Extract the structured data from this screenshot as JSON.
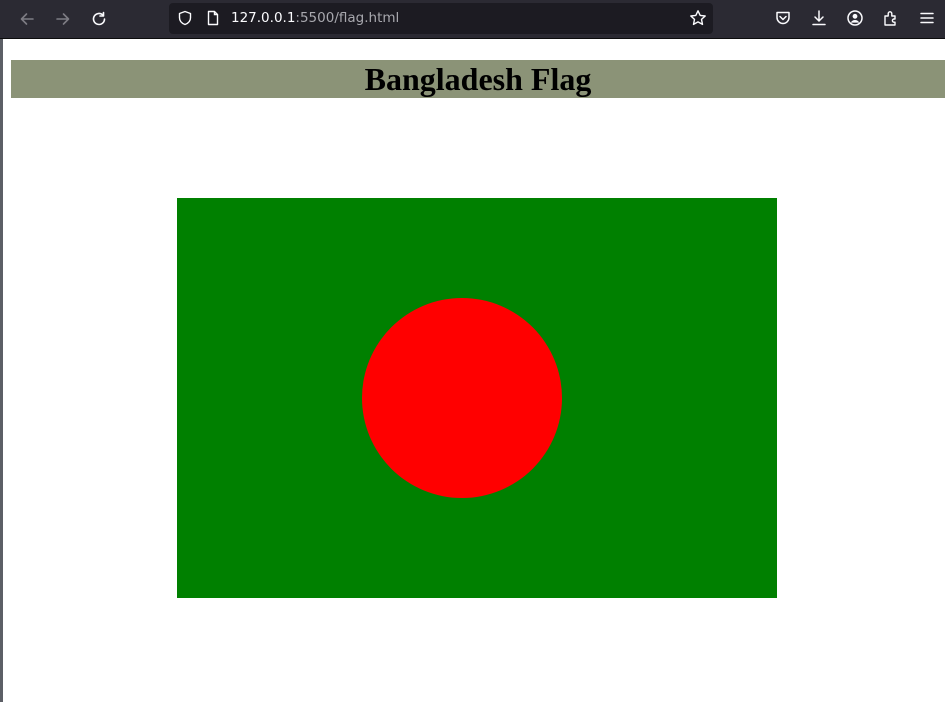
{
  "browser": {
    "url_host": "127.0.0.1",
    "url_rest": ":5500/flag.html",
    "icons": {
      "back": "back-arrow-icon",
      "forward": "forward-arrow-icon",
      "reload": "reload-icon",
      "security": "shield-icon",
      "page": "page-icon",
      "bookmark": "star-icon",
      "pocket": "pocket-icon",
      "downloads": "download-icon",
      "account": "account-icon",
      "extensions": "extensions-icon",
      "menu": "hamburger-menu-icon"
    }
  },
  "page": {
    "title": "Bangladesh Flag",
    "title_background": "#8b9377"
  },
  "flag": {
    "field_color": "#008000",
    "disc_color": "#ff0000"
  }
}
